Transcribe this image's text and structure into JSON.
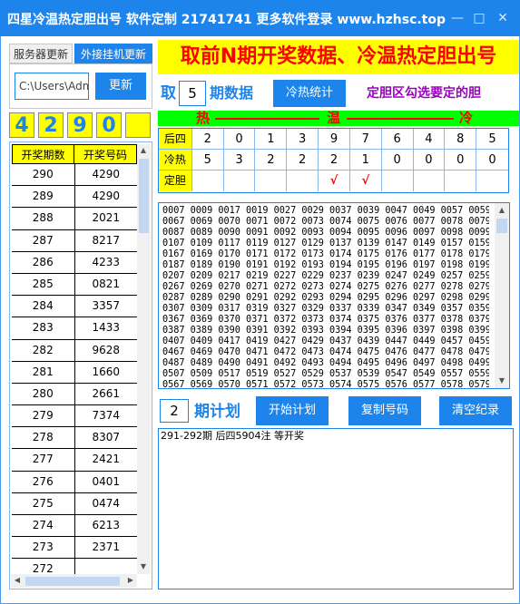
{
  "window": {
    "title": "四星冷温热定胆出号 软件定制 21741741 更多软件登录 www.hzhsc.top"
  },
  "tabs": [
    "服务器更新",
    "外接挂机更新"
  ],
  "path_input": {
    "value": "C:\\Users\\Adm"
  },
  "refresh_label": "更新",
  "current_digits": [
    "4",
    "2",
    "9",
    "0",
    ""
  ],
  "history": {
    "headers": [
      "开奖期数",
      "开奖号码"
    ],
    "rows": [
      [
        "290",
        "4290"
      ],
      [
        "289",
        "4290"
      ],
      [
        "288",
        "2021"
      ],
      [
        "287",
        "8217"
      ],
      [
        "286",
        "4233"
      ],
      [
        "285",
        "0821"
      ],
      [
        "284",
        "3357"
      ],
      [
        "283",
        "1433"
      ],
      [
        "282",
        "9628"
      ],
      [
        "281",
        "1660"
      ],
      [
        "280",
        "2661"
      ],
      [
        "279",
        "7374"
      ],
      [
        "278",
        "8307"
      ],
      [
        "277",
        "2421"
      ],
      [
        "276",
        "0401"
      ],
      [
        "275",
        "0474"
      ],
      [
        "274",
        "6213"
      ],
      [
        "273",
        "2371"
      ],
      [
        "272",
        ""
      ]
    ]
  },
  "headline": "取前N期开奖数据、冷温热定胆出号",
  "controls": {
    "take_label": "取",
    "n_value": "5",
    "period_data_label": "期数据",
    "stats_button": "冷热统计",
    "hint": "定胆区勾选要定的胆"
  },
  "heat_scale": {
    "hot": "热",
    "warm": "温",
    "cold": "冷"
  },
  "grid": {
    "row_labels": [
      "后四",
      "冷热",
      "定胆"
    ],
    "digits": [
      "2",
      "0",
      "1",
      "3",
      "9",
      "7",
      "6",
      "4",
      "8",
      "5"
    ],
    "heat": [
      "5",
      "3",
      "2",
      "2",
      "2",
      "1",
      "0",
      "0",
      "0",
      "0"
    ],
    "picks": [
      "",
      "",
      "",
      "",
      "√",
      "√",
      "",
      "",
      "",
      ""
    ]
  },
  "numbers_lines": [
    "0007 0009 0017 0019 0027 0029 0037 0039 0047 0049 0057 0059",
    "0067 0069 0070 0071 0072 0073 0074 0075 0076 0077 0078 0079",
    "0087 0089 0090 0091 0092 0093 0094 0095 0096 0097 0098 0099",
    "0107 0109 0117 0119 0127 0129 0137 0139 0147 0149 0157 0159",
    "0167 0169 0170 0171 0172 0173 0174 0175 0176 0177 0178 0179",
    "0187 0189 0190 0191 0192 0193 0194 0195 0196 0197 0198 0199",
    "0207 0209 0217 0219 0227 0229 0237 0239 0247 0249 0257 0259",
    "0267 0269 0270 0271 0272 0273 0274 0275 0276 0277 0278 0279",
    "0287 0289 0290 0291 0292 0293 0294 0295 0296 0297 0298 0299",
    "0307 0309 0317 0319 0327 0329 0337 0339 0347 0349 0357 0359",
    "0367 0369 0370 0371 0372 0373 0374 0375 0376 0377 0378 0379",
    "0387 0389 0390 0391 0392 0393 0394 0395 0396 0397 0398 0399",
    "0407 0409 0417 0419 0427 0429 0437 0439 0447 0449 0457 0459",
    "0467 0469 0470 0471 0472 0473 0474 0475 0476 0477 0478 0479",
    "0487 0489 0490 0491 0492 0493 0494 0495 0496 0497 0498 0499",
    "0507 0509 0517 0519 0527 0529 0537 0539 0547 0549 0557 0559",
    "0567 0569 0570 0571 0572 0573 0574 0575 0576 0577 0578 0579"
  ],
  "plan": {
    "periods_value": "2",
    "periods_label": "期计划",
    "start_button": "开始计划",
    "copy_button": "复制号码",
    "clear_button": "清空纪录"
  },
  "output_text": "291-292期 后四5904注 等开奖"
}
